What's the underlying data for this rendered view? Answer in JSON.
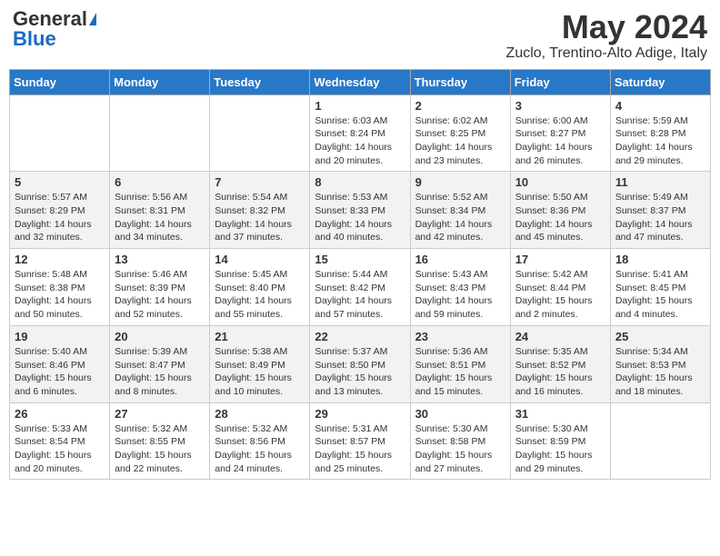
{
  "header": {
    "logo_general": "General",
    "logo_blue": "Blue",
    "month": "May 2024",
    "location": "Zuclo, Trentino-Alto Adige, Italy"
  },
  "weekdays": [
    "Sunday",
    "Monday",
    "Tuesday",
    "Wednesday",
    "Thursday",
    "Friday",
    "Saturday"
  ],
  "weeks": [
    [
      {
        "day": "",
        "info": ""
      },
      {
        "day": "",
        "info": ""
      },
      {
        "day": "",
        "info": ""
      },
      {
        "day": "1",
        "info": "Sunrise: 6:03 AM\nSunset: 8:24 PM\nDaylight: 14 hours\nand 20 minutes."
      },
      {
        "day": "2",
        "info": "Sunrise: 6:02 AM\nSunset: 8:25 PM\nDaylight: 14 hours\nand 23 minutes."
      },
      {
        "day": "3",
        "info": "Sunrise: 6:00 AM\nSunset: 8:27 PM\nDaylight: 14 hours\nand 26 minutes."
      },
      {
        "day": "4",
        "info": "Sunrise: 5:59 AM\nSunset: 8:28 PM\nDaylight: 14 hours\nand 29 minutes."
      }
    ],
    [
      {
        "day": "5",
        "info": "Sunrise: 5:57 AM\nSunset: 8:29 PM\nDaylight: 14 hours\nand 32 minutes."
      },
      {
        "day": "6",
        "info": "Sunrise: 5:56 AM\nSunset: 8:31 PM\nDaylight: 14 hours\nand 34 minutes."
      },
      {
        "day": "7",
        "info": "Sunrise: 5:54 AM\nSunset: 8:32 PM\nDaylight: 14 hours\nand 37 minutes."
      },
      {
        "day": "8",
        "info": "Sunrise: 5:53 AM\nSunset: 8:33 PM\nDaylight: 14 hours\nand 40 minutes."
      },
      {
        "day": "9",
        "info": "Sunrise: 5:52 AM\nSunset: 8:34 PM\nDaylight: 14 hours\nand 42 minutes."
      },
      {
        "day": "10",
        "info": "Sunrise: 5:50 AM\nSunset: 8:36 PM\nDaylight: 14 hours\nand 45 minutes."
      },
      {
        "day": "11",
        "info": "Sunrise: 5:49 AM\nSunset: 8:37 PM\nDaylight: 14 hours\nand 47 minutes."
      }
    ],
    [
      {
        "day": "12",
        "info": "Sunrise: 5:48 AM\nSunset: 8:38 PM\nDaylight: 14 hours\nand 50 minutes."
      },
      {
        "day": "13",
        "info": "Sunrise: 5:46 AM\nSunset: 8:39 PM\nDaylight: 14 hours\nand 52 minutes."
      },
      {
        "day": "14",
        "info": "Sunrise: 5:45 AM\nSunset: 8:40 PM\nDaylight: 14 hours\nand 55 minutes."
      },
      {
        "day": "15",
        "info": "Sunrise: 5:44 AM\nSunset: 8:42 PM\nDaylight: 14 hours\nand 57 minutes."
      },
      {
        "day": "16",
        "info": "Sunrise: 5:43 AM\nSunset: 8:43 PM\nDaylight: 14 hours\nand 59 minutes."
      },
      {
        "day": "17",
        "info": "Sunrise: 5:42 AM\nSunset: 8:44 PM\nDaylight: 15 hours\nand 2 minutes."
      },
      {
        "day": "18",
        "info": "Sunrise: 5:41 AM\nSunset: 8:45 PM\nDaylight: 15 hours\nand 4 minutes."
      }
    ],
    [
      {
        "day": "19",
        "info": "Sunrise: 5:40 AM\nSunset: 8:46 PM\nDaylight: 15 hours\nand 6 minutes."
      },
      {
        "day": "20",
        "info": "Sunrise: 5:39 AM\nSunset: 8:47 PM\nDaylight: 15 hours\nand 8 minutes."
      },
      {
        "day": "21",
        "info": "Sunrise: 5:38 AM\nSunset: 8:49 PM\nDaylight: 15 hours\nand 10 minutes."
      },
      {
        "day": "22",
        "info": "Sunrise: 5:37 AM\nSunset: 8:50 PM\nDaylight: 15 hours\nand 13 minutes."
      },
      {
        "day": "23",
        "info": "Sunrise: 5:36 AM\nSunset: 8:51 PM\nDaylight: 15 hours\nand 15 minutes."
      },
      {
        "day": "24",
        "info": "Sunrise: 5:35 AM\nSunset: 8:52 PM\nDaylight: 15 hours\nand 16 minutes."
      },
      {
        "day": "25",
        "info": "Sunrise: 5:34 AM\nSunset: 8:53 PM\nDaylight: 15 hours\nand 18 minutes."
      }
    ],
    [
      {
        "day": "26",
        "info": "Sunrise: 5:33 AM\nSunset: 8:54 PM\nDaylight: 15 hours\nand 20 minutes."
      },
      {
        "day": "27",
        "info": "Sunrise: 5:32 AM\nSunset: 8:55 PM\nDaylight: 15 hours\nand 22 minutes."
      },
      {
        "day": "28",
        "info": "Sunrise: 5:32 AM\nSunset: 8:56 PM\nDaylight: 15 hours\nand 24 minutes."
      },
      {
        "day": "29",
        "info": "Sunrise: 5:31 AM\nSunset: 8:57 PM\nDaylight: 15 hours\nand 25 minutes."
      },
      {
        "day": "30",
        "info": "Sunrise: 5:30 AM\nSunset: 8:58 PM\nDaylight: 15 hours\nand 27 minutes."
      },
      {
        "day": "31",
        "info": "Sunrise: 5:30 AM\nSunset: 8:59 PM\nDaylight: 15 hours\nand 29 minutes."
      },
      {
        "day": "",
        "info": ""
      }
    ]
  ]
}
